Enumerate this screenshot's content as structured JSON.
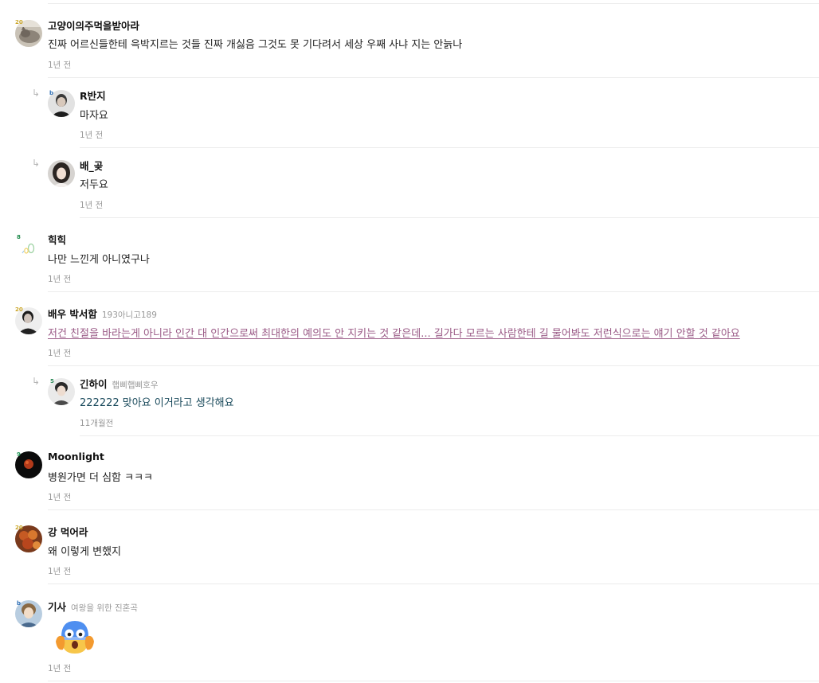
{
  "comments": [
    {
      "nick": "고양이의주먹을받아라",
      "sub": "",
      "level": "20",
      "text": "진짜 어르신들한테 윽박지르는 것들 진짜 개싫음 그것도 못 기다려서 세상 우째 사냐 지는 안늙나",
      "time": "1년 전",
      "avatar": "cat-avatar"
    },
    {
      "nick": "R반지",
      "sub": "",
      "level": "b",
      "text": "마자요",
      "time": "1년 전",
      "avatar": "man-avatar"
    },
    {
      "nick": "배_곶",
      "sub": "",
      "level": "",
      "text": "저두요",
      "time": "1년 전",
      "avatar": "woman-avatar"
    },
    {
      "nick": "힉힉",
      "sub": "",
      "level": "8",
      "text": "나만 느낀게 아니였구나",
      "time": "1년 전",
      "avatar": "doodle-avatar"
    },
    {
      "nick": "배우 박서함",
      "sub": "193아니고189",
      "level": "20",
      "text": "저건 친절을 바라는게 아니라 인간 대 인간으로써 최대한의 예의도 안 지키는 것 같은데... 길가다 모르는 사람한테 길 물어봐도 저런식으로는 얘기 안할 것 같아요",
      "time": "1년 전",
      "avatar": "actor-avatar"
    },
    {
      "nick": "긴하이",
      "sub": "햅삐햅삐호우",
      "level": "5",
      "text": "222222 맞아요 이거라고 생각해요",
      "time": "11개월전",
      "avatar": "boy-avatar"
    },
    {
      "nick": "Moonlight",
      "sub": "",
      "level": "9",
      "text": "병원가면 더 심함 ㅋㅋㅋ",
      "time": "1년 전",
      "avatar": "moon-avatar"
    },
    {
      "nick": "강 먹어라",
      "sub": "",
      "level": "20",
      "text": "왜 이렇게 변했지",
      "time": "1년 전",
      "avatar": "food-avatar"
    },
    {
      "nick": "기사",
      "sub": "여왕을 위한 진혼곡",
      "level": "b",
      "text": "",
      "time": "1년 전",
      "avatar": "knight-avatar",
      "emoji": "shocked-face-emoji"
    }
  ],
  "colors": {
    "link": "#9a5a86",
    "teal": "#17485a",
    "meta": "#999999",
    "separator": "#ececec"
  },
  "icons": {
    "reply": "↳"
  }
}
